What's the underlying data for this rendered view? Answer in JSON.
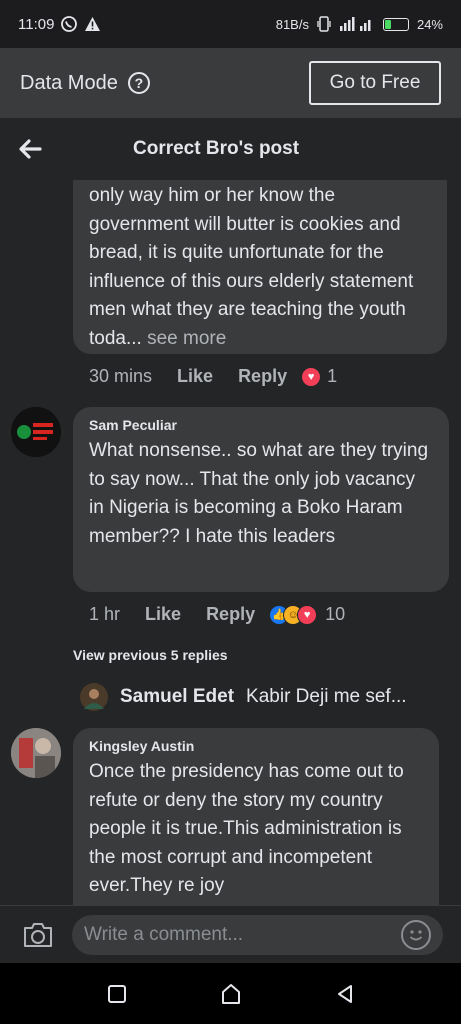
{
  "status": {
    "time": "11:09",
    "speed": "81B/s",
    "battery": "24%",
    "battery_level": 0.24
  },
  "data_bar": {
    "label": "Data Mode",
    "help": "?",
    "go_free": "Go to Free"
  },
  "header": {
    "title": "Correct Bro's post"
  },
  "comments": [
    {
      "text": "only way him or her know the government will butter is cookies and bread, it is quite unfortunate for the influence of this ours elderly statement men what they are teaching the youth toda...",
      "see_more": " see more",
      "time": "30 mins",
      "like": "Like",
      "reply": "Reply",
      "reaction_count": "1"
    },
    {
      "name": "Sam Peculiar",
      "text": "What nonsense.. so what are they trying to say now... That the only job vacancy in Nigeria is becoming a Boko Haram member?? I hate this leaders",
      "time": "1 hr",
      "like": "Like",
      "reply": "Reply",
      "reaction_count": "10"
    },
    {
      "name": "Kingsley Austin",
      "text": "Once the presidency has come out to refute or deny the story my country people it is true.This administration is the most corrupt and incompetent ever.They re joy"
    }
  ],
  "replies": {
    "view_previous": "View previous 5 replies",
    "latest_name": "Samuel Edet",
    "latest_text": "Kabir Deji me sef..."
  },
  "composer": {
    "placeholder": "Write a comment..."
  },
  "colors": {
    "background": "#242526",
    "bubble": "#3a3b3c",
    "text": "#e4e6eb",
    "muted": "#b0b3b8",
    "love": "#f33e58",
    "like": "#1877f2",
    "haha": "#f7b125"
  }
}
